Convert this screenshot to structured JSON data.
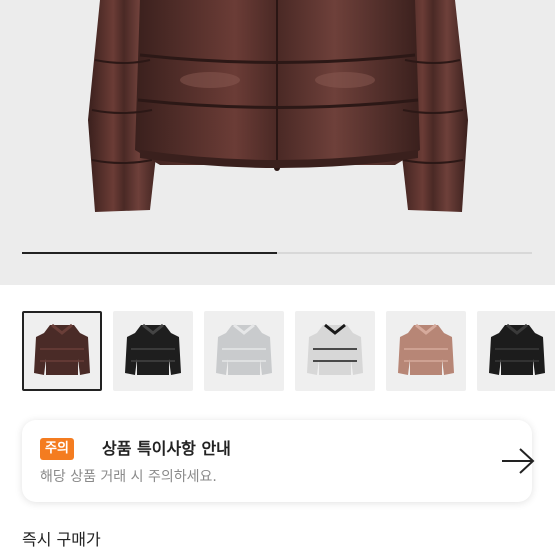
{
  "product": {
    "gallery": {
      "progress": 0.5,
      "thumbnails": [
        {
          "color": "#4a2b27",
          "selected": true,
          "accent": "#6a3e38"
        },
        {
          "color": "#1e1e1e",
          "selected": false,
          "accent": "#444444"
        },
        {
          "color": "#c9cbcd",
          "selected": false,
          "accent": "#e6e7e8"
        },
        {
          "color": "#d7d7d7",
          "selected": false,
          "accent": "#1a1a1a"
        },
        {
          "color": "#b78676",
          "selected": false,
          "accent": "#d6aa9c"
        },
        {
          "color": "#1c1c1c",
          "selected": false,
          "accent": "#3a3a3a"
        }
      ]
    },
    "notice": {
      "badge": "주의",
      "title": "상품 특이사항 안내",
      "subtitle": "해당 상품 거래 시 주의하세요.",
      "accent_color": "#f47c20"
    },
    "price_section": {
      "label": "즉시 구매가"
    }
  }
}
